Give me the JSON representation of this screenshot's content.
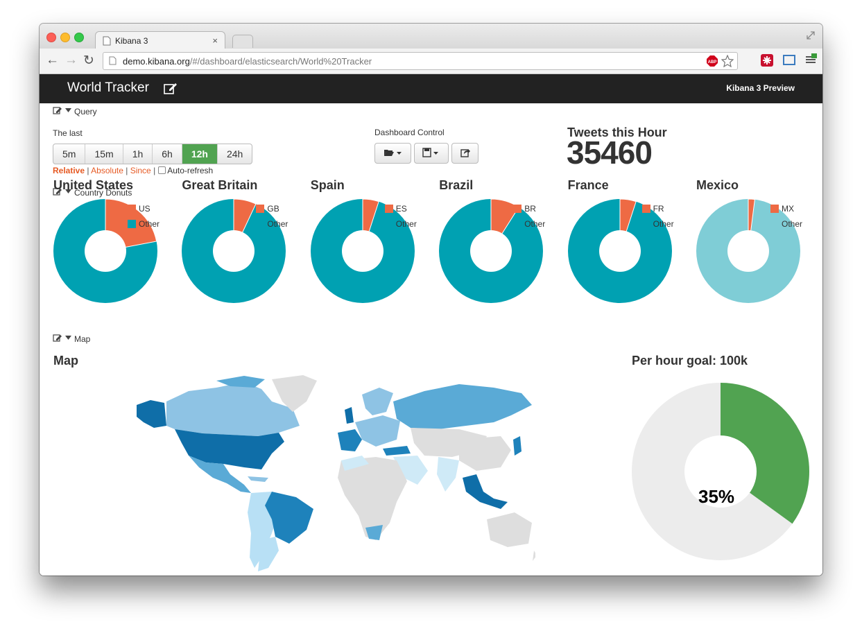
{
  "browser": {
    "tab_title": "Kibana 3",
    "tab_close": "×",
    "url_host": "demo.kibana.org",
    "url_path": "/#/dashboard/elasticsearch/World%20Tracker",
    "nav": {
      "back": "←",
      "forward": "→",
      "reload": "↻"
    }
  },
  "navbar": {
    "title": "World Tracker",
    "preview": "Kibana 3 Preview"
  },
  "query_row": {
    "label": "Query",
    "the_last": "The last",
    "timespans": [
      "5m",
      "15m",
      "1h",
      "6h",
      "12h",
      "24h"
    ],
    "active": "12h",
    "modes": [
      "Relative",
      "Absolute",
      "Since"
    ],
    "auto_refresh": "Auto-refresh",
    "dashboard_control": "Dashboard Control"
  },
  "metric": {
    "title": "Tweets this Hour",
    "value": "35460"
  },
  "donut_row": {
    "label": "Country Donuts",
    "donuts": [
      {
        "title": "United States",
        "code": "US",
        "other": "Other",
        "share": 0.22,
        "other_color": "#00a1b2"
      },
      {
        "title": "Great Britain",
        "code": "GB",
        "other": "Other",
        "share": 0.07,
        "other_color": "#00a1b2"
      },
      {
        "title": "Spain",
        "code": "ES",
        "other": "Other",
        "share": 0.05,
        "other_color": "#00a1b2"
      },
      {
        "title": "Brazil",
        "code": "BR",
        "other": "Other",
        "share": 0.09,
        "other_color": "#00a1b2"
      },
      {
        "title": "France",
        "code": "FR",
        "other": "Other",
        "share": 0.05,
        "other_color": "#00a1b2"
      },
      {
        "title": "Mexico",
        "code": "MX",
        "other": "Other",
        "share": 0.02,
        "other_color": "#7fcdd6"
      }
    ]
  },
  "map_row": {
    "label": "Map",
    "map_title": "Map",
    "goal_title": "Per hour goal: 100k",
    "goal_percent": 35,
    "goal_label": "35%"
  },
  "colors": {
    "orange": "#ee6a44",
    "teal": "#00a1b2",
    "green": "#51a351",
    "navbar": "#222222"
  }
}
